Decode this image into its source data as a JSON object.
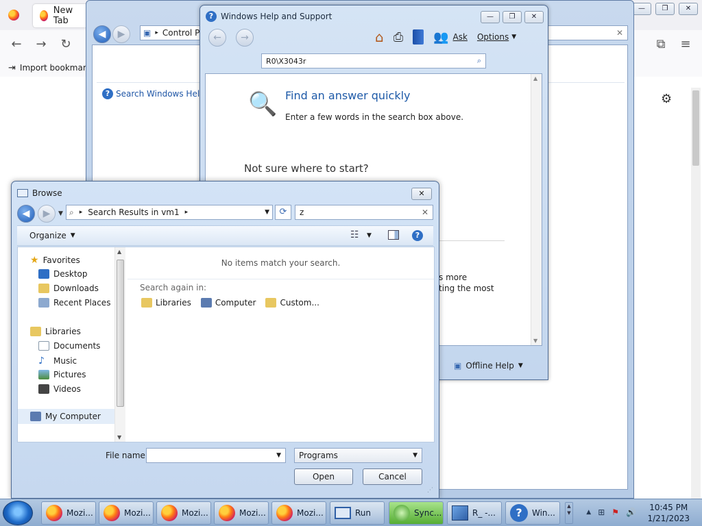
{
  "firefox": {
    "tab_label": "New Tab",
    "bookmark_import": "Import bookmark"
  },
  "control_panel": {
    "address": "Control P",
    "help_link": "Search Windows Help a"
  },
  "help": {
    "title": "Windows Help and Support",
    "ask_label": "Ask",
    "options_label": "Options",
    "search_value": "R0\\X3043r",
    "find_heading": "Find an answer quickly",
    "find_sub": "Enter a few words in the search box above.",
    "not_sure": "Not sure where to start?",
    "partial_line1": "s more",
    "partial_line2": "ting the most",
    "offline_help": "Offline Help"
  },
  "browse": {
    "title": "Browse",
    "address": "Search Results in vm1",
    "search_value": "z",
    "organize": "Organize",
    "no_items": "No items match your search.",
    "search_again": "Search again in:",
    "search_again_items": [
      "Libraries",
      "Computer",
      "Custom..."
    ],
    "nav": {
      "favorites": "Favorites",
      "desktop": "Desktop",
      "downloads": "Downloads",
      "recent": "Recent Places",
      "libraries": "Libraries",
      "documents": "Documents",
      "music": "Music",
      "pictures": "Pictures",
      "videos": "Videos",
      "computer": "My Computer"
    },
    "file_name_label": "File name:",
    "file_name_value": "",
    "file_type": "Programs",
    "open_label": "Open",
    "cancel_label": "Cancel"
  },
  "taskbar": {
    "items": [
      "Mozi...",
      "Mozi...",
      "Mozi...",
      "Mozi...",
      "Mozi...",
      "Run",
      "Sync...",
      "R_ -...",
      "Win..."
    ],
    "time": "10:45 PM",
    "date": "1/21/2023"
  }
}
